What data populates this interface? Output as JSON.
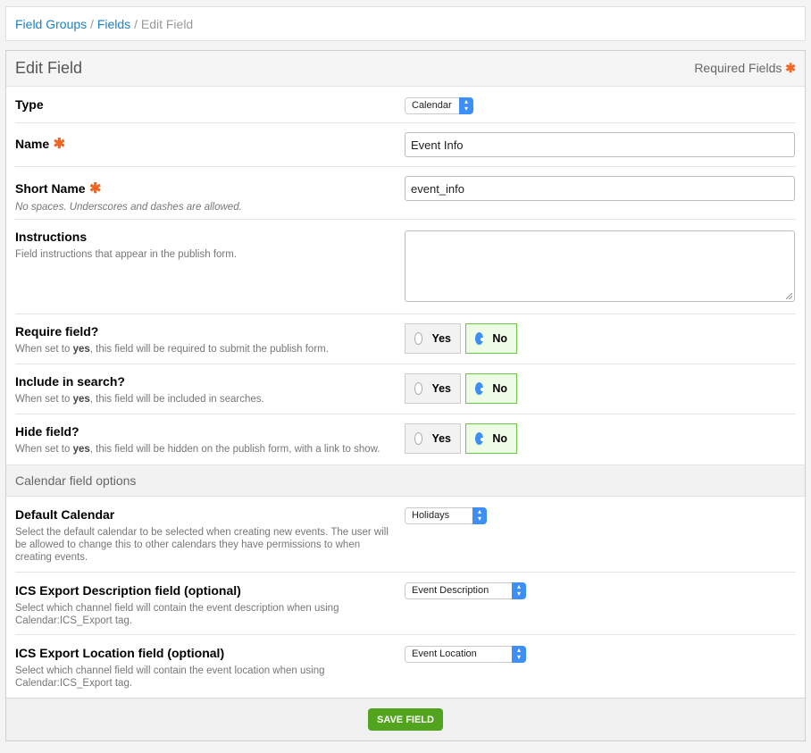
{
  "breadcrumb": {
    "items": [
      "Field Groups",
      "Fields"
    ],
    "separator": "/",
    "current": "Edit Field"
  },
  "panel": {
    "title": "Edit Field",
    "required_label": "Required Fields",
    "required_marker": "✱"
  },
  "fields": {
    "type": {
      "label": "Type",
      "value": "Calendar"
    },
    "name": {
      "label": "Name",
      "value": "Event Info"
    },
    "short_name": {
      "label": "Short Name",
      "desc": "No spaces. Underscores and dashes are allowed.",
      "value": "event_info"
    },
    "instructions": {
      "label": "Instructions",
      "desc": "Field instructions that appear in the publish form.",
      "value": ""
    },
    "require": {
      "label": "Require field?",
      "desc_pre": "When set to ",
      "desc_bold": "yes",
      "desc_post": ", this field will be required to submit the publish form.",
      "yes": "Yes",
      "no": "No",
      "selected": "No"
    },
    "search": {
      "label": "Include in search?",
      "desc_pre": "When set to ",
      "desc_bold": "yes",
      "desc_post": ", this field will be included in searches.",
      "yes": "Yes",
      "no": "No",
      "selected": "No"
    },
    "hide": {
      "label": "Hide field?",
      "desc_pre": "When set to ",
      "desc_bold": "yes",
      "desc_post": ", this field will be hidden on the publish form, with a link to show.",
      "yes": "Yes",
      "no": "No",
      "selected": "No"
    }
  },
  "calendar_options": {
    "title": "Calendar field options",
    "default_calendar": {
      "label": "Default Calendar",
      "desc": "Select the default calendar to be selected when creating new events. The user will be allowed to change this to other calendars they have permissions to when creating events.",
      "value": "Holidays"
    },
    "ics_description": {
      "label": "ICS Export Description field (optional)",
      "desc": "Select which channel field will contain the event description when using Calendar:ICS_Export tag.",
      "value": "Event Description"
    },
    "ics_location": {
      "label": "ICS Export Location field (optional)",
      "desc": "Select which channel field will contain the event location when using Calendar:ICS_Export tag.",
      "value": "Event Location"
    }
  },
  "footer": {
    "save_label": "SAVE FIELD"
  },
  "colors": {
    "link": "#1f80c0",
    "required": "#f26522",
    "save": "#52a41f",
    "selected_border": "#6cc644",
    "select_accent": "#3d8ef5"
  }
}
